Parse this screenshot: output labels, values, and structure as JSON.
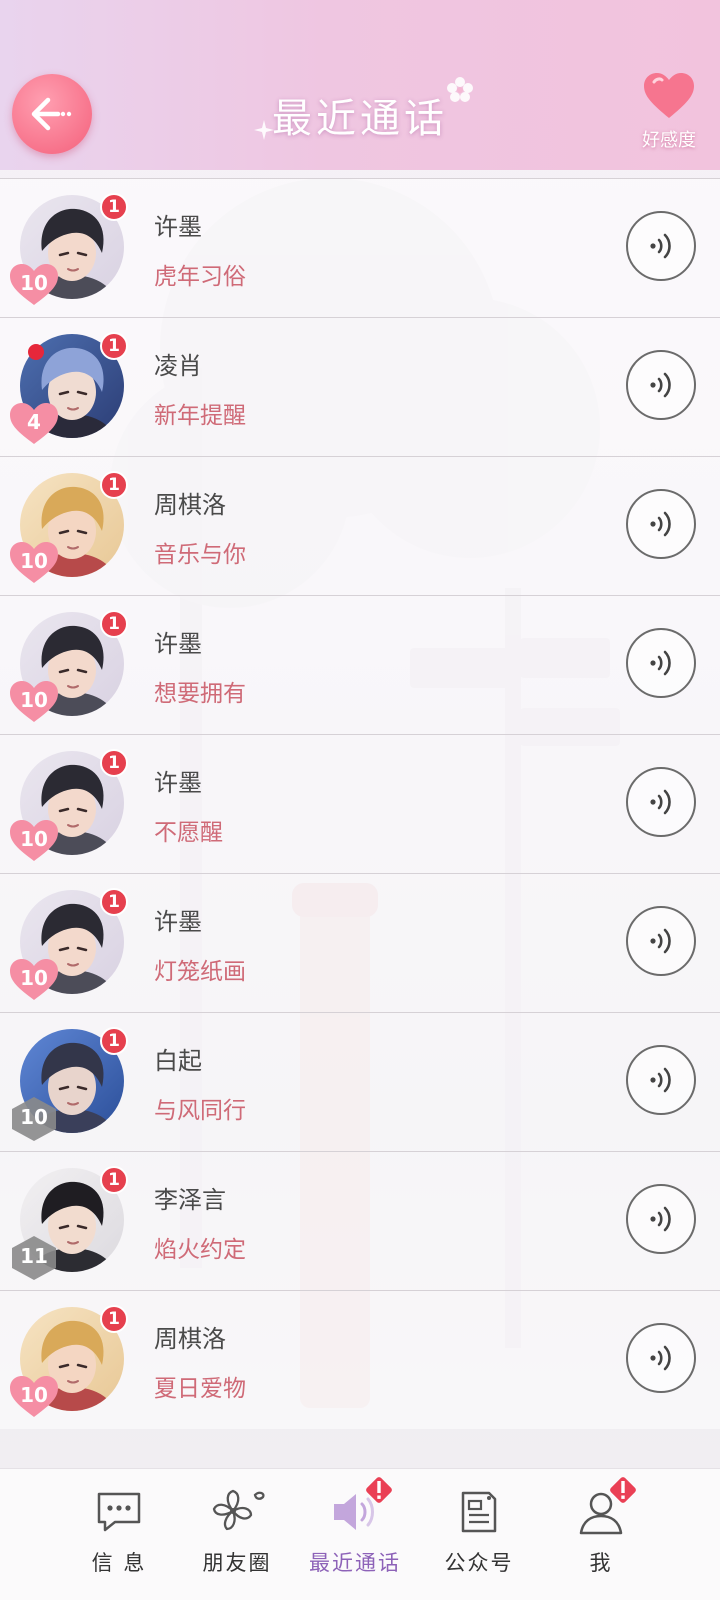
{
  "header": {
    "title": "最近通话",
    "favor_label": "好感度"
  },
  "calls": [
    {
      "name": "许墨",
      "topic": "虎年习俗",
      "unread": "1",
      "level": "10",
      "level_style": "pink",
      "avatar": "xumo"
    },
    {
      "name": "凌肖",
      "topic": "新年提醒",
      "unread": "1",
      "level": "4",
      "level_style": "pink",
      "avatar": "lingxiao"
    },
    {
      "name": "周棋洛",
      "topic": "音乐与你",
      "unread": "1",
      "level": "10",
      "level_style": "pink",
      "avatar": "zhouqiluo"
    },
    {
      "name": "许墨",
      "topic": "想要拥有",
      "unread": "1",
      "level": "10",
      "level_style": "pink",
      "avatar": "xumo"
    },
    {
      "name": "许墨",
      "topic": "不愿醒",
      "unread": "1",
      "level": "10",
      "level_style": "pink",
      "avatar": "xumo"
    },
    {
      "name": "许墨",
      "topic": "灯笼纸画",
      "unread": "1",
      "level": "10",
      "level_style": "pink",
      "avatar": "xumo"
    },
    {
      "name": "白起",
      "topic": "与风同行",
      "unread": "1",
      "level": "10",
      "level_style": "gray",
      "avatar": "baiqi"
    },
    {
      "name": "李泽言",
      "topic": "焰火约定",
      "unread": "1",
      "level": "11",
      "level_style": "gray",
      "avatar": "lizeyan"
    },
    {
      "name": "周棋洛",
      "topic": "夏日爱物",
      "unread": "1",
      "level": "10",
      "level_style": "pink",
      "avatar": "zhouqiluo"
    }
  ],
  "tabs": [
    {
      "label": "信 息",
      "icon": "chat-bubble-icon",
      "alert": false
    },
    {
      "label": "朋友圈",
      "icon": "sakura-flower-icon",
      "alert": false
    },
    {
      "label": "最近通话",
      "icon": "speaker-icon",
      "alert": true
    },
    {
      "label": "公众号",
      "icon": "document-icon",
      "alert": false
    },
    {
      "label": "我",
      "icon": "person-icon",
      "alert": true
    }
  ],
  "colors": {
    "accent_pink": "#f4607b",
    "topic_text": "#cf6a77",
    "badge_red": "#e6404e",
    "active_tab": "#8d62b8",
    "level_gray": "#8a8a8a"
  }
}
